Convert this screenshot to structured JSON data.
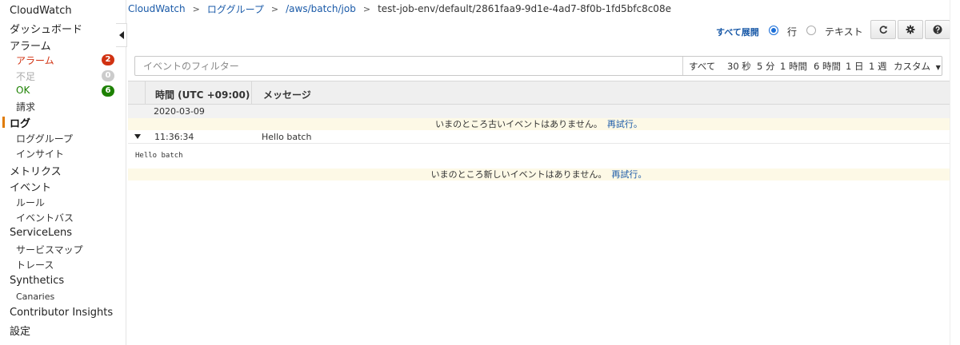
{
  "sidebar": {
    "cloudwatch": "CloudWatch",
    "dashboards": "ダッシュボード",
    "alarms": "アラーム",
    "alarm_items": [
      {
        "label": "アラーム",
        "count": "2",
        "color": "#d13212"
      },
      {
        "label": "不足",
        "count": "0",
        "color": "#cccccc"
      },
      {
        "label": "OK",
        "count": "6",
        "color": "#1d8102"
      }
    ],
    "billing": "請求",
    "logs": "ログ",
    "log_groups": "ロググループ",
    "insights": "インサイト",
    "metrics": "メトリクス",
    "events": "イベント",
    "rules": "ルール",
    "event_buses": "イベントバス",
    "servicelens": "ServiceLens",
    "service_map": "サービスマップ",
    "traces": "トレース",
    "synthetics": "Synthetics",
    "canaries": "Canaries",
    "contributor_insights": "Contributor Insights",
    "settings": "設定"
  },
  "breadcrumb": {
    "items": [
      "CloudWatch",
      "ロググループ",
      "/aws/batch/job"
    ],
    "current": "test-job-env/default/2861faa9-9d1e-4ad7-8f0b-1fd5bfc8c08e"
  },
  "toolbar": {
    "expand_all": "すべて展開",
    "view_row": "行",
    "view_text": "テキスト",
    "selected_view": "行"
  },
  "filter": {
    "placeholder": "イベントのフィルター",
    "value": "",
    "ranges": [
      "すべて",
      "30 秒",
      "5 分",
      "1 時間",
      "6 時間",
      "1 日",
      "1 週"
    ],
    "custom": "カスタム"
  },
  "table": {
    "col_time": "時間 (UTC +09:00)",
    "col_message": "メッセージ",
    "date": "2020-03-09",
    "notice_older": "いまのところ古いイベントはありません。",
    "notice_newer": "いまのところ新しいイベントはありません。",
    "retry": "再試行。",
    "events": [
      {
        "time": "11:36:34",
        "message": "Hello batch",
        "detail": "Hello batch"
      }
    ]
  },
  "colors": {
    "link": "#1a5aa8",
    "active_indicator": "#e07b00",
    "notice_bg": "#fdf9e6"
  }
}
